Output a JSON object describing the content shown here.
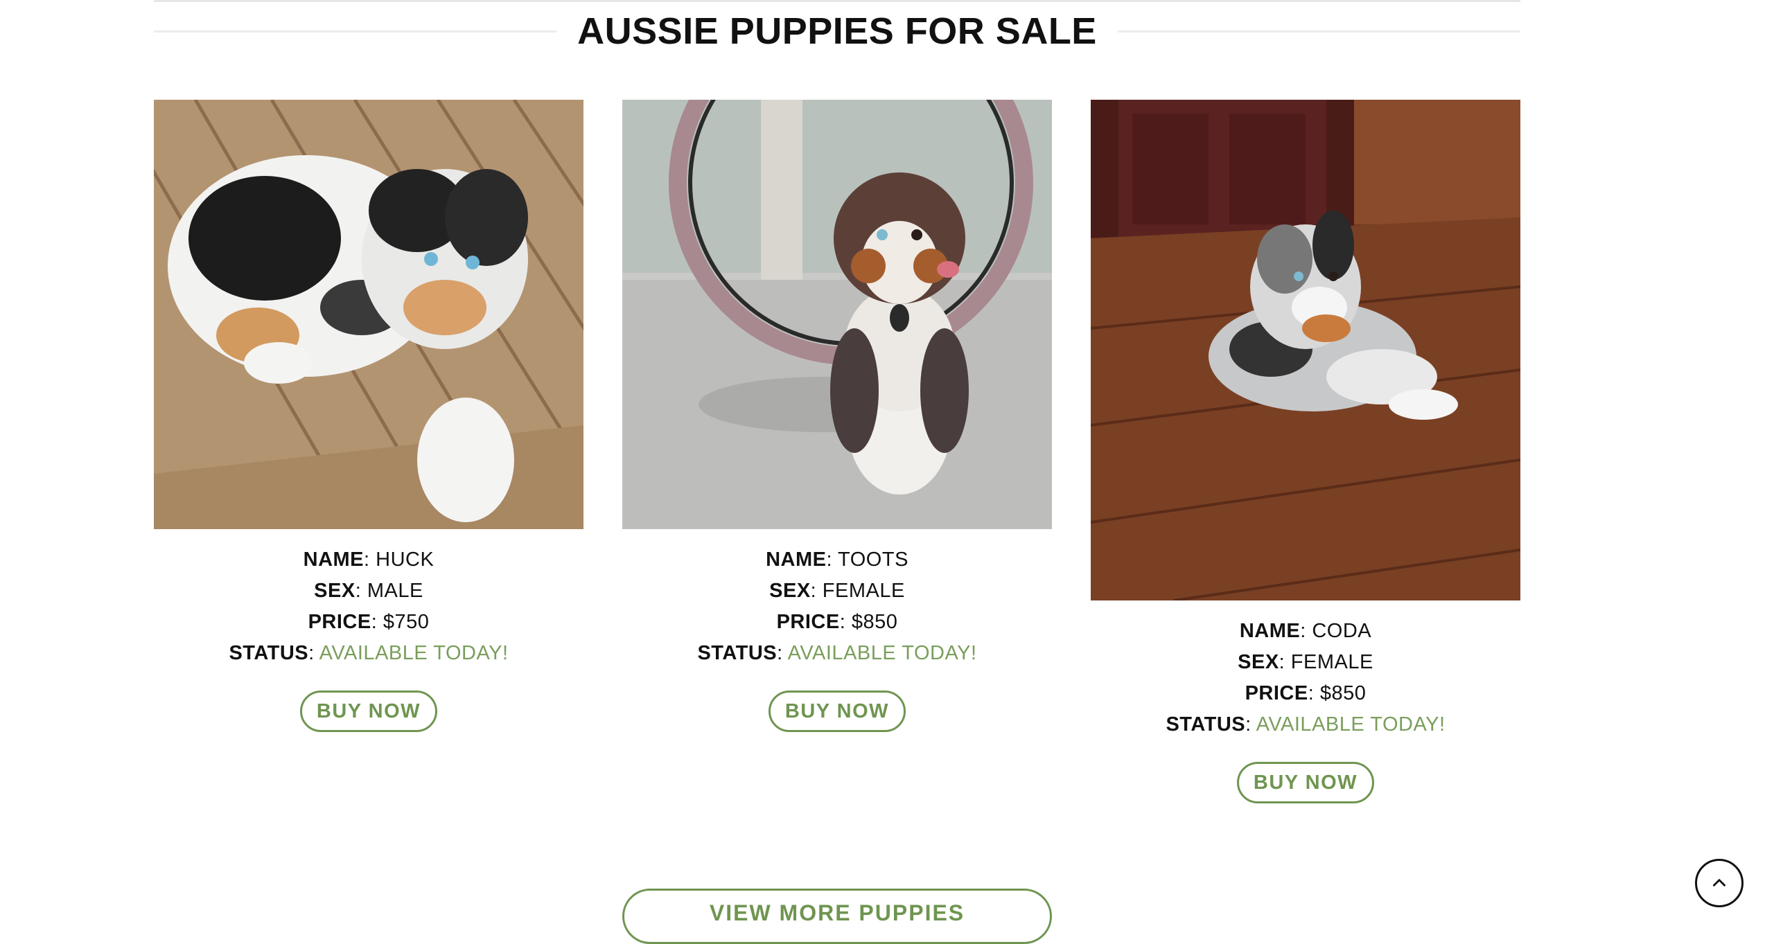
{
  "section": {
    "title": "AUSSIE PUPPIES FOR SALE"
  },
  "labels": {
    "name": "NAME",
    "sex": "SEX",
    "price": "PRICE",
    "status": "STATUS"
  },
  "puppies": [
    {
      "name": "HUCK",
      "sex": "MALE",
      "price": "$750",
      "status": "AVAILABLE TODAY!",
      "button": "BUY NOW"
    },
    {
      "name": "TOOTS",
      "sex": "FEMALE",
      "price": "$850",
      "status": "AVAILABLE TODAY!",
      "button": "BUY NOW"
    },
    {
      "name": "CODA",
      "sex": "FEMALE",
      "price": "$850",
      "status": "AVAILABLE TODAY!",
      "button": "BUY NOW"
    }
  ],
  "view_more_label": "VIEW MORE PUPPIES",
  "icons": {
    "back_to_top": "chevron-up-icon"
  },
  "colors": {
    "accent": "#6f9550",
    "status": "#7a9e5b",
    "text": "#111111"
  }
}
